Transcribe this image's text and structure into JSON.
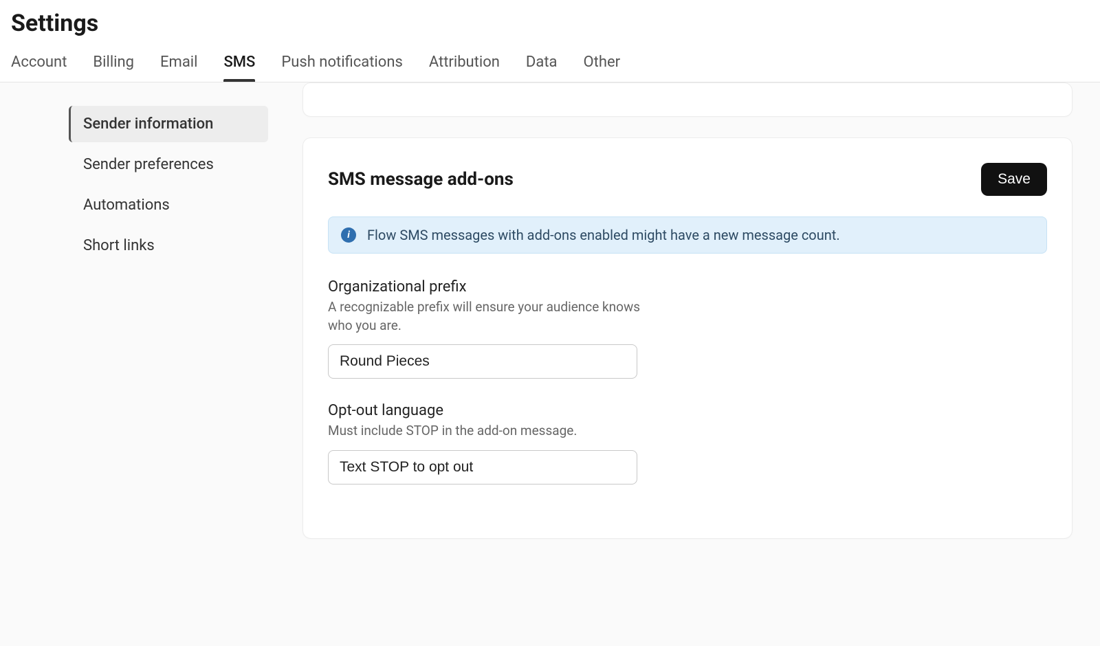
{
  "page_title": "Settings",
  "tabs": [
    {
      "label": "Account",
      "active": false
    },
    {
      "label": "Billing",
      "active": false
    },
    {
      "label": "Email",
      "active": false
    },
    {
      "label": "SMS",
      "active": true
    },
    {
      "label": "Push notifications",
      "active": false
    },
    {
      "label": "Attribution",
      "active": false
    },
    {
      "label": "Data",
      "active": false
    },
    {
      "label": "Other",
      "active": false
    }
  ],
  "sidebar": {
    "items": [
      {
        "label": "Sender information",
        "active": true
      },
      {
        "label": "Sender preferences",
        "active": false
      },
      {
        "label": "Automations",
        "active": false
      },
      {
        "label": "Short links",
        "active": false
      }
    ]
  },
  "card": {
    "title": "SMS message add-ons",
    "save_label": "Save",
    "banner_text": "Flow SMS messages with add-ons enabled might have a new message count.",
    "org_prefix": {
      "label": "Organizational prefix",
      "desc": "A recognizable prefix will ensure your audience knows who you are.",
      "value": "Round Pieces"
    },
    "opt_out": {
      "label": "Opt-out language",
      "desc": "Must include STOP in the add-on message.",
      "value": "Text STOP to opt out"
    }
  }
}
